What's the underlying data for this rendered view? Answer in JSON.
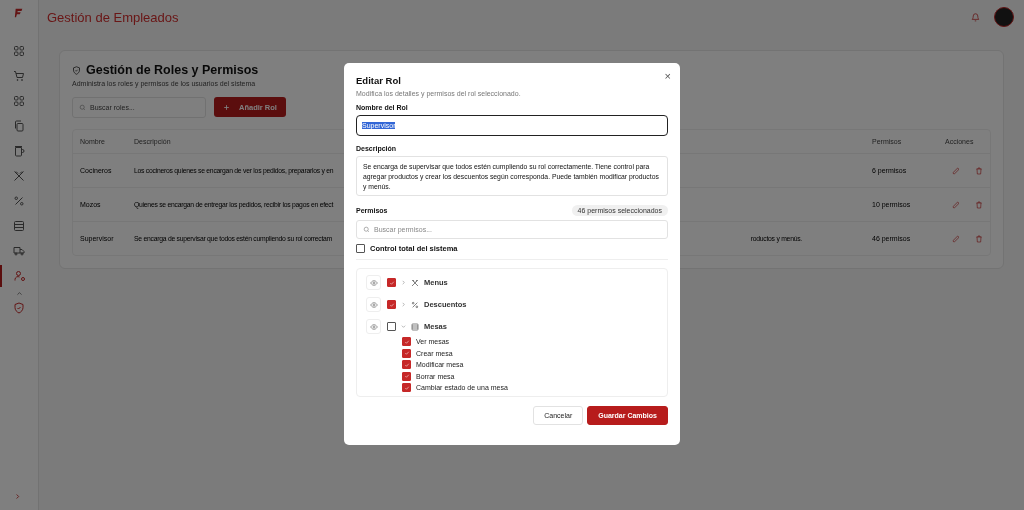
{
  "app": {
    "title": "Gestión de Empleados"
  },
  "sidebar": {
    "items": [
      {
        "selected": false
      },
      {
        "selected": false
      },
      {
        "selected": false
      },
      {
        "selected": false
      },
      {
        "selected": false
      },
      {
        "selected": false
      },
      {
        "selected": false
      },
      {
        "selected": false
      },
      {
        "selected": false
      },
      {
        "selected": true,
        "expanded": true,
        "children": [
          {
            "selected": true
          }
        ]
      }
    ]
  },
  "page": {
    "title": "Gestión de Roles y Permisos",
    "subtitle": "Administra los roles y permisos de los usuarios del sistema",
    "search": {
      "placeholder": "Buscar roles..."
    },
    "add_button": "Añadir Rol",
    "table": {
      "columns": [
        "Nombre",
        "Descripción",
        "Permisos",
        "Acciones"
      ],
      "rows": [
        {
          "name": "Cocineros",
          "description_start": "Los cocineros quienes se encargan de ver los pedidos, prepararlos y en",
          "permissions": "6 permisos"
        },
        {
          "name": "Mozos",
          "description_start": "Quienes se encargan de entregar los pedidos, recibir los pagos en efect",
          "permissions": "10 permisos"
        },
        {
          "name": "Supervisor",
          "description_start": "Se encarga de supervisar que todos estén cumpliendo su rol correctam",
          "description_end": "roductos y menús.",
          "permissions": "46 permisos"
        }
      ]
    }
  },
  "dialog": {
    "title": "Editar Rol",
    "subtitle": "Modifica los detalles y permisos del rol seleccionado.",
    "close": "×",
    "name_label": "Nombre del Rol",
    "name_value": "Supervisor",
    "name_selected": true,
    "description_label": "Descripción",
    "description_value": "Se encarga de supervisar que todos estén cumpliendo su rol correctamente. Tiene control para agregar productos y crear los descuentos según corresponda. Puede también modificar productos y menús.",
    "permissions_label": "Permisos",
    "permissions_badge": "46 permisos seleccionados",
    "permissions_search": {
      "placeholder": "Buscar permisos..."
    },
    "full_control": {
      "label": "Control total del sistema",
      "checked": false
    },
    "groups": [
      {
        "label": "Menus",
        "checked": true,
        "expanded": false
      },
      {
        "label": "Descuentos",
        "checked": true,
        "expanded": false
      },
      {
        "label": "Mesas",
        "checked": false,
        "expanded": true,
        "children": [
          {
            "label": "Ver mesas",
            "checked": true
          },
          {
            "label": "Crear mesa",
            "checked": true
          },
          {
            "label": "Modificar mesa",
            "checked": true
          },
          {
            "label": "Borrar mesa",
            "checked": true
          },
          {
            "label": "Cambiar estado de una mesa",
            "checked": true
          }
        ]
      }
    ],
    "buttons": [
      {
        "label": "Cancelar",
        "kind": "secondary"
      },
      {
        "label": "Guardar Cambios",
        "kind": "primary"
      }
    ]
  }
}
